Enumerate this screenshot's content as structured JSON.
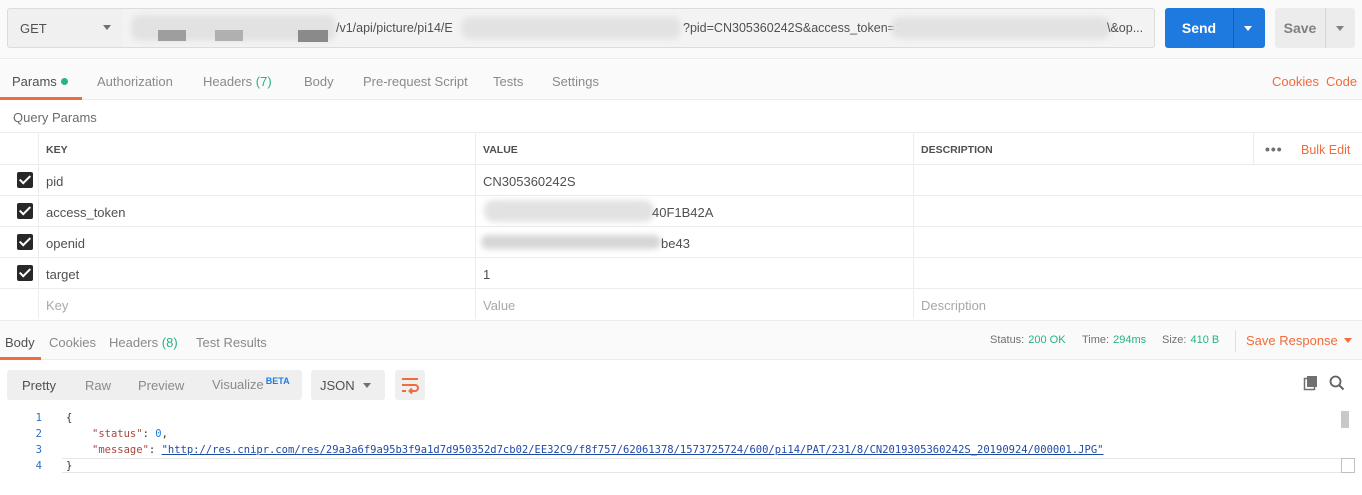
{
  "request": {
    "method": "GET",
    "url_parts": {
      "path": "/v1/api/picture/pi14/E",
      "query_mid": "?pid=CN305360242S&access_token=1",
      "query_end": "\\&op..."
    },
    "send_label": "Send",
    "save_label": "Save"
  },
  "request_tabs": [
    {
      "label": "Params"
    },
    {
      "label": "Authorization"
    },
    {
      "label": "Headers",
      "count": "(7)"
    },
    {
      "label": "Body"
    },
    {
      "label": "Pre-request Script"
    },
    {
      "label": "Tests"
    },
    {
      "label": "Settings"
    }
  ],
  "request_links": {
    "cookies": "Cookies",
    "code": "Code"
  },
  "query_params": {
    "title": "Query Params",
    "columns": {
      "key": "KEY",
      "value": "VALUE",
      "description": "DESCRIPTION"
    },
    "more": "•••",
    "bulk_edit": "Bulk Edit",
    "rows": [
      {
        "key": "pid",
        "value": "CN305360242S",
        "checked": true
      },
      {
        "key": "access_token",
        "value": "40F1B42A",
        "checked": true
      },
      {
        "key": "openid",
        "value": "be43",
        "checked": true
      },
      {
        "key": "target",
        "value": "1",
        "checked": true
      }
    ],
    "placeholders": {
      "key": "Key",
      "value": "Value",
      "description": "Description"
    }
  },
  "response": {
    "tabs": [
      {
        "label": "Body"
      },
      {
        "label": "Cookies"
      },
      {
        "label": "Headers",
        "count": "(8)"
      },
      {
        "label": "Test Results"
      }
    ],
    "status_label": "Status:",
    "status_value": "200 OK",
    "time_label": "Time:",
    "time_value": "294ms",
    "size_label": "Size:",
    "size_value": "410 B",
    "save_response": "Save Response",
    "views": [
      {
        "label": "Pretty"
      },
      {
        "label": "Raw"
      },
      {
        "label": "Preview"
      },
      {
        "label": "Visualize",
        "badge": "BETA"
      }
    ],
    "format": "JSON",
    "code": {
      "line_numbers": [
        "1",
        "2",
        "3",
        "4"
      ],
      "open_brace": "{",
      "status_key": "\"status\"",
      "status_value": "0",
      "message_key": "\"message\"",
      "message_value": "\"http://res.cnipr.com/res/29a3a6f9a95b3f9a1d7d950352d7cb02/EE32C9/f8f757/62061378/1573725724/600/pi14/PAT/231/8/CN2019305360242S_20190924/000001.JPG\"",
      "close_brace": "}"
    }
  },
  "colors": {
    "accent": "#f26b3a",
    "send": "#1f7ae0",
    "success": "#26b47f"
  }
}
